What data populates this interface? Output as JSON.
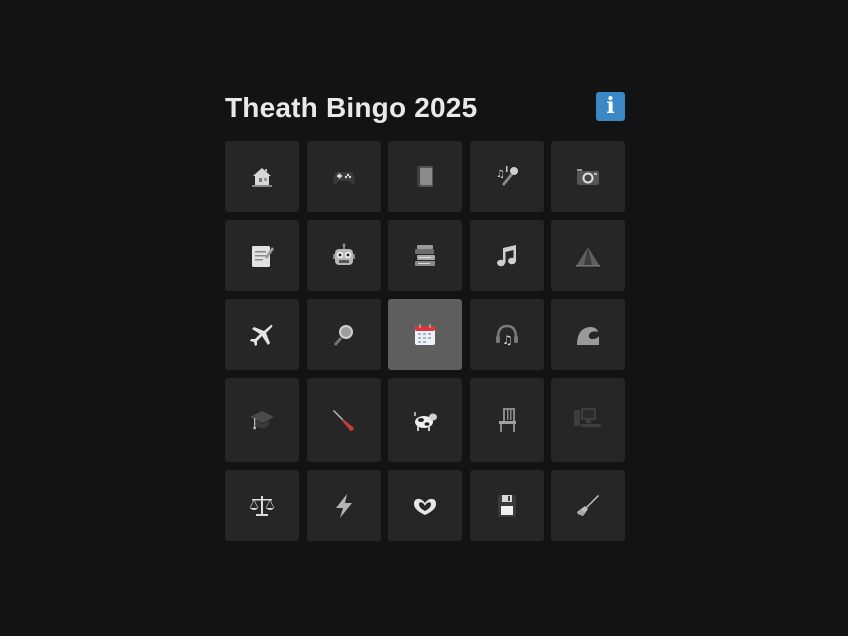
{
  "title": "Theath Bingo 2025",
  "info_label": "i",
  "colors": {
    "background": "#131313",
    "cell": "#262626",
    "cell_marked": "#5e5e5e",
    "info": "#3b88c6"
  },
  "board": [
    [
      {
        "icon": "house-icon",
        "marked": false
      },
      {
        "icon": "game-controller-icon",
        "marked": false
      },
      {
        "icon": "book-icon",
        "marked": false
      },
      {
        "icon": "microphone-icon",
        "marked": false
      },
      {
        "icon": "camera-icon",
        "marked": false
      }
    ],
    [
      {
        "icon": "memo-icon",
        "marked": false
      },
      {
        "icon": "robot-icon",
        "marked": false
      },
      {
        "icon": "books-icon",
        "marked": false
      },
      {
        "icon": "music-note-icon",
        "marked": false
      },
      {
        "icon": "tent-icon",
        "marked": false
      }
    ],
    [
      {
        "icon": "airplane-icon",
        "marked": false
      },
      {
        "icon": "magnifying-glass-icon",
        "marked": false
      },
      {
        "icon": "calendar-icon",
        "marked": true
      },
      {
        "icon": "headphones-icon",
        "marked": false
      },
      {
        "icon": "wave-icon",
        "marked": false
      }
    ],
    [
      {
        "icon": "graduation-cap-icon",
        "marked": false
      },
      {
        "icon": "screwdriver-icon",
        "marked": false
      },
      {
        "icon": "cow-icon",
        "marked": false
      },
      {
        "icon": "chair-icon",
        "marked": false
      },
      {
        "icon": "desktop-computer-icon",
        "marked": false
      }
    ],
    [
      {
        "icon": "balance-scale-icon",
        "marked": false
      },
      {
        "icon": "lightning-icon",
        "marked": false
      },
      {
        "icon": "heart-hands-icon",
        "marked": false
      },
      {
        "icon": "floppy-disk-icon",
        "marked": false
      },
      {
        "icon": "broom-icon",
        "marked": false
      }
    ]
  ]
}
